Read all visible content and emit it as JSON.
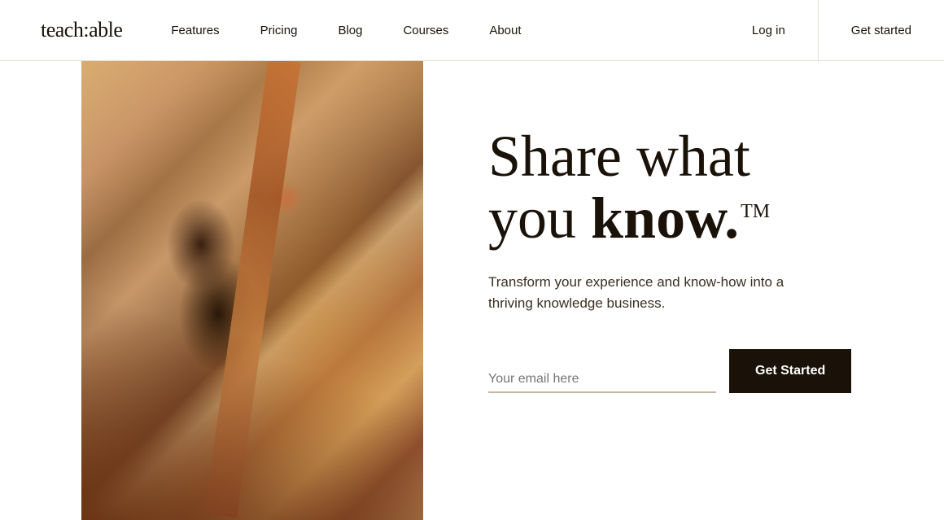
{
  "nav": {
    "logo": "teach:able",
    "links": [
      {
        "id": "features",
        "label": "Features"
      },
      {
        "id": "pricing",
        "label": "Pricing"
      },
      {
        "id": "blog",
        "label": "Blog"
      },
      {
        "id": "courses",
        "label": "Courses"
      },
      {
        "id": "about",
        "label": "About"
      }
    ],
    "login_label": "Log in",
    "get_started_label": "Get started"
  },
  "hero": {
    "headline_line1": "Share what",
    "headline_line2_prefix": "you ",
    "headline_line2_bold": "know.",
    "headline_tm": "TM",
    "subheadline": "Transform your experience and know-how into a thriving knowledge business.",
    "email_placeholder": "Your email here",
    "cta_button_label": "Get Started"
  }
}
